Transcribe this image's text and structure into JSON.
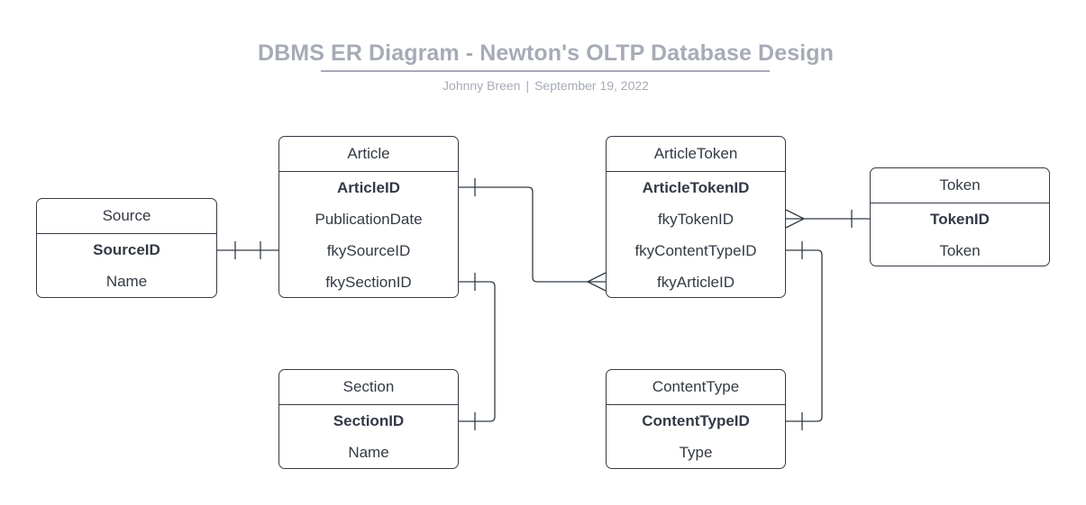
{
  "header": {
    "title": "DBMS ER Diagram - Newton's OLTP Database Design",
    "author": "Johnny Breen",
    "separator": "|",
    "date": "September 19, 2022"
  },
  "entities": {
    "source": {
      "name": "Source",
      "fields": [
        "SourceID",
        "Name"
      ]
    },
    "article": {
      "name": "Article",
      "fields": [
        "ArticleID",
        "PublicationDate",
        "fkySourceID",
        "fkySectionID"
      ]
    },
    "section": {
      "name": "Section",
      "fields": [
        "SectionID",
        "Name"
      ]
    },
    "article_token": {
      "name": "ArticleToken",
      "fields": [
        "ArticleTokenID",
        "fkyTokenID",
        "fkyContentTypeID",
        "fkyArticleID"
      ]
    },
    "token": {
      "name": "Token",
      "fields": [
        "TokenID",
        "Token"
      ]
    },
    "content_type": {
      "name": "ContentType",
      "fields": [
        "ContentTypeID",
        "Type"
      ]
    }
  },
  "relationships": [
    {
      "from": "Source.SourceID",
      "to": "Article.fkySourceID",
      "from_end": "one",
      "to_end": "one"
    },
    {
      "from": "Article.ArticleID",
      "to": "ArticleToken.fkyArticleID",
      "from_end": "one",
      "to_end": "many"
    },
    {
      "from": "Section.SectionID",
      "to": "Article.fkySectionID",
      "from_end": "one",
      "to_end": "one"
    },
    {
      "from": "Token.TokenID",
      "to": "ArticleToken.fkyTokenID",
      "from_end": "one",
      "to_end": "many"
    },
    {
      "from": "ContentType.ContentTypeID",
      "to": "ArticleToken.fkyContentTypeID",
      "from_end": "one",
      "to_end": "one"
    }
  ]
}
